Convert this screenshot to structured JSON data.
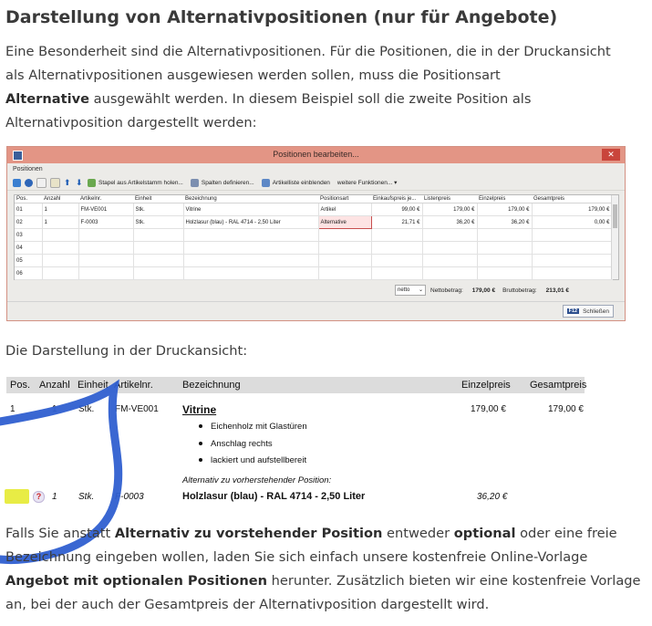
{
  "heading": "Darstellung von Alternativpositionen (nur für Angebote)",
  "intro": {
    "line1": "Eine Besonderheit sind die Alternativpositionen. Für die Positionen, die in der Druckansicht",
    "line2": "als Alternativpositionen ausgewiesen werden sollen, muss die Positionsart",
    "line3_bold": "Alternative",
    "line3_rest": " ausgewählt werden. In diesem Beispiel soll die zweite Position als",
    "line4": "Alternativposition dargestellt werden:"
  },
  "window": {
    "title": "Positionen bearbeiten...",
    "close_glyph": "✕",
    "section_label": "Positionen",
    "toolbar": {
      "import_label": "Stapel aus Artikelstamm holen...",
      "columns_label": "Spalten definieren...",
      "article_list_label": "Artikelliste einblenden",
      "more_label": "weitere Funktionen... ▾"
    },
    "columns": [
      "Pos.",
      "Anzahl",
      "Artikelnr.",
      "Einheit",
      "Bezeichnung",
      "Positionsart",
      "Einkaufspreis je...",
      "Listenpreis",
      "Einzelpreis",
      "Gesamtpreis"
    ],
    "rows": [
      {
        "pos": "01",
        "anzahl": "1",
        "artikelnr": "FM-VE001",
        "einheit": "Stk.",
        "bezeichnung": "Vitrine",
        "positionsart": "Artikel",
        "ek": "99,00 €",
        "listenpreis": "179,00 €",
        "einzelpreis": "179,00 €",
        "gesamtpreis": "179,00 €"
      },
      {
        "pos": "02",
        "anzahl": "1",
        "artikelnr": "F-0003",
        "einheit": "Stk.",
        "bezeichnung": "Holzlasur (blau) - RAL 4714 - 2,50 Liter",
        "positionsart": "Alternative",
        "ek": "21,71 €",
        "listenpreis": "36,20 €",
        "einzelpreis": "36,20 €",
        "gesamtpreis": "0,00 €"
      },
      {
        "pos": "03"
      },
      {
        "pos": "04"
      },
      {
        "pos": "05"
      },
      {
        "pos": "06"
      }
    ],
    "totals": {
      "mode": "netto",
      "net_label": "Nettobetrag:",
      "net_value": "179,00 €",
      "gross_label": "Bruttobetrag:",
      "gross_value": "213,01 €"
    },
    "close_key": "F12",
    "close_label": "Schließen"
  },
  "print_intro": "Die Darstellung in der Druckansicht:",
  "print_view": {
    "headers": {
      "pos": "Pos.",
      "anzahl": "Anzahl",
      "einheit": "Einheit",
      "artikelnr": "Artikelnr.",
      "bezeichnung": "Bezeichnung",
      "einzelpreis": "Einzelpreis",
      "gesamtpreis": "Gesamtpreis"
    },
    "row1": {
      "pos": "1",
      "anzahl": "1",
      "einheit": "Stk.",
      "artikelnr": "FM-VE001",
      "bezeichnung": "Vitrine",
      "einzelpreis": "179,00 €",
      "gesamtpreis": "179,00 €",
      "bullets": [
        "Eichenholz mit Glastüren",
        "Anschlag rechts",
        "lackiert und aufstellbereit"
      ]
    },
    "alt_note": "Alternativ zu vorherstehender Position:",
    "row2": {
      "help_glyph": "?",
      "anzahl": "1",
      "einheit": "Stk.",
      "artikelnr": "F-0003",
      "bezeichnung": "Holzlasur (blau) - RAL 4714 - 2,50 Liter",
      "einzelpreis": "36,20 €"
    }
  },
  "outro": {
    "l1a": "Falls Sie anstatt ",
    "l1b_bold": "Alternativ zu vorstehender Position",
    "l1c": " entweder ",
    "l1d_bold": "optional",
    "l1e": " oder eine freie",
    "l2": "Bezeichnung eingeben wollen, laden Sie sich einfach unsere kostenfreie Online-Vorlage",
    "l3a_bold": "Angebot mit optionalen Positionen",
    "l3b": " herunter. Zusätzlich bieten wir eine kostenfreie Vorlage",
    "l4": "an, bei der auch der Gesamtpreis der Alternativposition dargestellt wird."
  },
  "colors": {
    "annotation_stroke": "#2f5fd0",
    "highlight": "#e8ec45",
    "alt_cell_border": "#c74e4e",
    "window_titlebar": "#e39585"
  }
}
